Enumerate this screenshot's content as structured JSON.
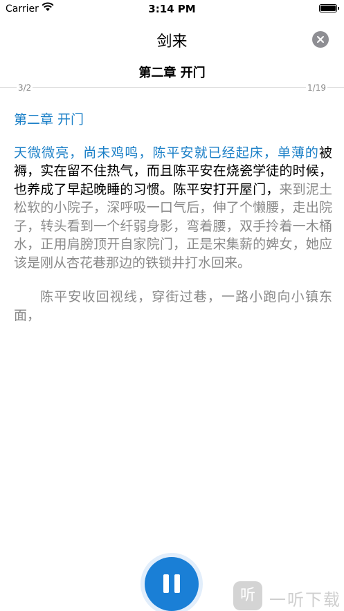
{
  "status_bar": {
    "carrier": "Carrier",
    "time": "3:14 PM"
  },
  "header": {
    "book_title": "剑来",
    "chapter": "第二章 开门"
  },
  "progress": {
    "page_left": "3/2",
    "page_right": "1/19"
  },
  "content": {
    "chapter_title": "第二章 开门",
    "p1_highlight": "天微微亮，尚未鸡鸣，陈平安就已经起床，单薄的",
    "p1_current": "被褥，实在留不住热气，而且陈平安在烧瓷学徒的时候，也养成了早起晚睡的习惯。陈平安打开屋门，",
    "p1_rest": "来到泥土松软的小院子，深呼吸一口气后，伸了个懒腰，走出院子，转头看到一个纤弱身影，弯着腰，双手拎着一木桶水，正用肩膀顶开自家院门，正是宋集薪的婢女，她应该是刚从杏花巷那边的铁锁井打水回来。",
    "p2": "陈平安收回视线，穿街过巷，一路小跑向小镇东面，"
  },
  "watermark": {
    "logo": "听",
    "text": "一听下载"
  },
  "colors": {
    "accent": "#1a7fc7",
    "button": "#1a7fd6",
    "muted": "#8a8a8a"
  }
}
